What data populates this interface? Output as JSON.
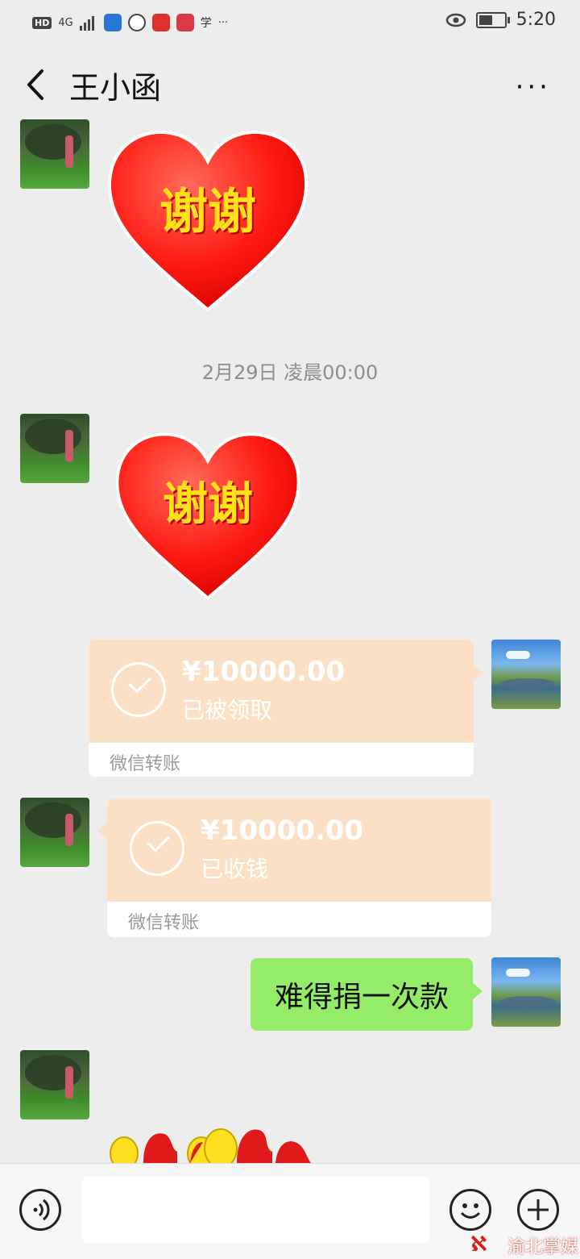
{
  "status_bar": {
    "time": "5:20",
    "hd": "HD",
    "network": "4G",
    "more": "···"
  },
  "header": {
    "title": "王小函",
    "more": "···"
  },
  "stickers": {
    "thanks_text": "谢谢"
  },
  "timestamp": "2月29日 凌晨00:00",
  "transfers": [
    {
      "amount": "¥10000.00",
      "status": "已被领取",
      "footer": "微信转账"
    },
    {
      "amount": "¥10000.00",
      "status": "已收钱",
      "footer": "微信转账"
    }
  ],
  "messages": [
    {
      "text": "难得捐一次款"
    }
  ],
  "watermark": {
    "text": "渝北掌媒"
  },
  "colors": {
    "sent_bubble": "#95ec69",
    "transfer_bg": "#fbe0c5",
    "background": "#ededed",
    "heart_red": "#ff1a12",
    "heart_text": "#ffe21a"
  }
}
